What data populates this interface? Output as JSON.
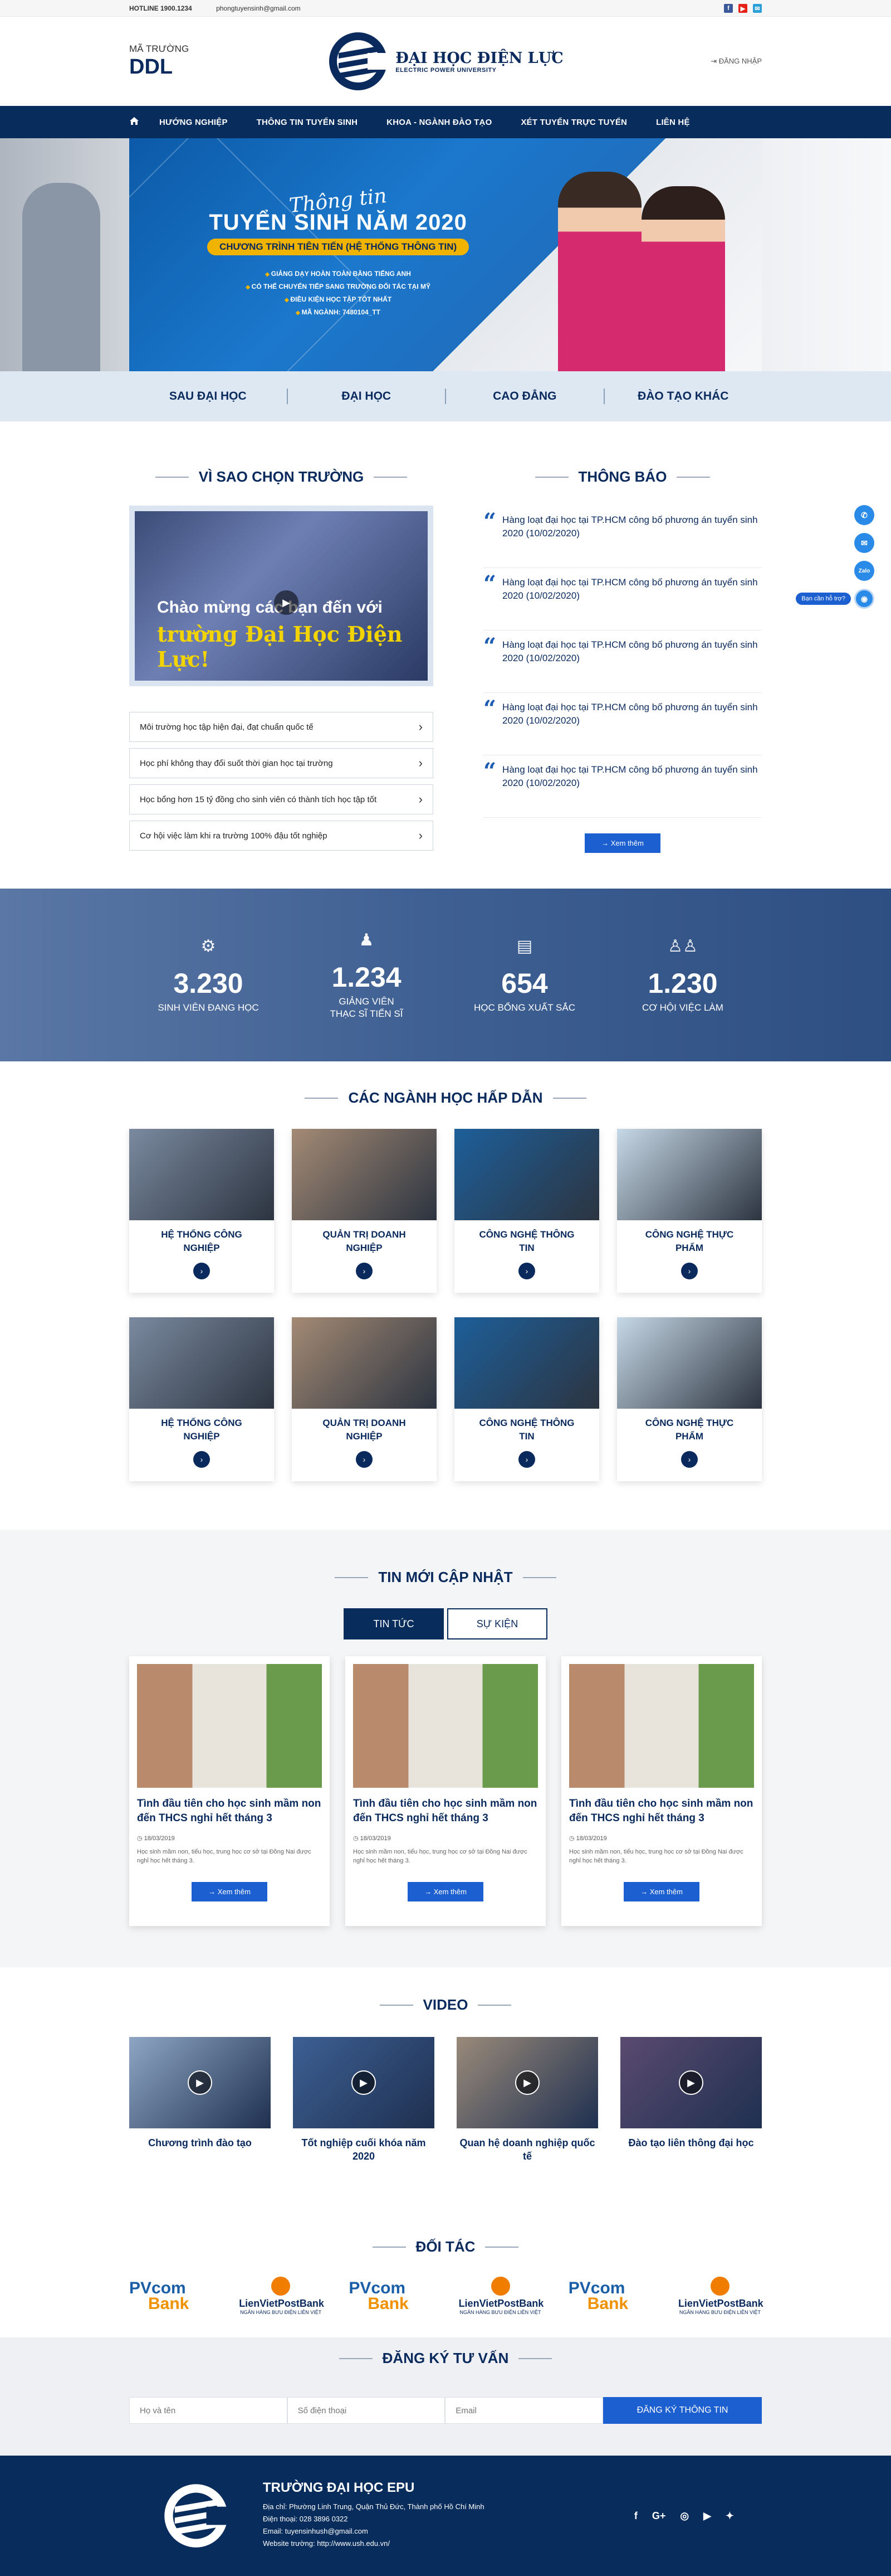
{
  "topbar": {
    "hotline": "HOTLINE 1900.1234",
    "email": "phongtuyensinh@gmail.com"
  },
  "header": {
    "code_label": "MÃ TRƯỜNG",
    "code": "DDL",
    "logo_title": "ĐẠI HỌC ĐIỆN LỰC",
    "logo_sub": "ELECTRIC POWER UNIVERSITY",
    "login": "ĐĂNG NHẬP"
  },
  "nav": [
    "HƯỚNG NGHIỆP",
    "THÔNG TIN TUYỂN SINH",
    "KHOA - NGÀNH ĐÀO TẠO",
    "XÉT TUYỂN TRỰC TUYẾN",
    "LIÊN HỆ"
  ],
  "hero": {
    "script": "Thông tin",
    "title": "TUYỂN SINH NĂM 2020",
    "pill": "CHƯƠNG TRÌNH TIÊN TIẾN (HỆ THỐNG THÔNG TIN)",
    "bullets": [
      "GIẢNG DẠY HOÀN TOÀN BẰNG TIẾNG ANH",
      "CÓ THỂ CHUYỂN TIẾP SANG TRƯỜNG ĐỐI TÁC TẠI MỸ",
      "ĐIỀU KIỆN HỌC TẬP TỐT NHẤT",
      "MÃ NGÀNH: 7480104_TT"
    ]
  },
  "programs": [
    "SAU ĐẠI HỌC",
    "ĐẠI HỌC",
    "CAO ĐẲNG",
    "ĐÀO TẠO KHÁC"
  ],
  "why": {
    "title": "VÌ SAO CHỌN TRƯỜNG",
    "video_line1": "Chào mừng các bạn đến với",
    "video_line2": "trường Đại Học Điện Lực!",
    "items": [
      "Môi trường học tập hiện đại, đạt chuẩn quốc tế",
      "Học phí không thay đổi suốt thời gian học tại trường",
      "Học bổng hơn 15 tỷ đồng cho sinh viên có thành tích học tập tốt",
      "Cơ hội việc làm khi ra trường 100% đậu tốt nghiệp"
    ]
  },
  "notices": {
    "title": "THÔNG BÁO",
    "items": [
      "Hàng loạt đại học tại TP.HCM công bố phương án tuyển sinh 2020 (10/02/2020)",
      "Hàng loạt đại học tại TP.HCM công bố phương án tuyển sinh 2020 (10/02/2020)",
      "Hàng loạt đại học tại TP.HCM công bố phương án tuyển sinh 2020 (10/02/2020)",
      "Hàng loạt đại học tại TP.HCM công bố phương án tuyển sinh 2020 (10/02/2020)",
      "Hàng loạt đại học tại TP.HCM công bố phương án tuyển sinh 2020 (10/02/2020)"
    ],
    "more": "Xem thêm"
  },
  "stats": [
    {
      "num": "3.230",
      "label": "SINH VIÊN ĐANG HỌC"
    },
    {
      "num": "1.234",
      "label": "GIẢNG VIÊN THẠC SĨ TIẾN SĨ"
    },
    {
      "num": "654",
      "label": "HỌC BỔNG XUẤT SẮC"
    },
    {
      "num": "1.230",
      "label": "CƠ HỘI VIỆC LÀM"
    }
  ],
  "majors": {
    "title": "CÁC NGÀNH HỌC HẤP DẪN",
    "items": [
      "HỆ THỐNG CÔNG NGHIỆP",
      "QUẢN TRỊ DOANH NGHIỆP",
      "CÔNG NGHỆ THÔNG TIN",
      "CÔNG NGHỆ THỰC PHẨM",
      "HỆ THỐNG CÔNG NGHIỆP",
      "QUẢN TRỊ DOANH NGHIỆP",
      "CÔNG NGHỆ THÔNG TIN",
      "CÔNG NGHỆ THỰC PHẨM"
    ],
    "colors": [
      "#7b8aa0",
      "#a48a74",
      "#1d5f9a",
      "#c7d8e6",
      "#7b8aa0",
      "#a48a74",
      "#1d5f9a",
      "#c7d8e6"
    ]
  },
  "news": {
    "title": "TIN MỚI CẬP NHẬT",
    "tab_news": "TIN TỨC",
    "tab_events": "SỰ KIỆN",
    "items": [
      {
        "title": "Tình đầu tiên cho học sinh mầm non đến THCS nghỉ hết tháng 3",
        "date": "18/03/2019",
        "desc": "Học sinh mầm non, tiểu học, trung học cơ sở tại Đồng Nai được nghỉ học hết tháng 3.",
        "more": "Xem thêm"
      },
      {
        "title": "Tình đầu tiên cho học sinh mầm non đến THCS nghỉ hết tháng 3",
        "date": "18/03/2019",
        "desc": "Học sinh mầm non, tiểu học, trung học cơ sở tại Đồng Nai được nghỉ học hết tháng 3.",
        "more": "Xem thêm"
      },
      {
        "title": "Tình đầu tiên cho học sinh mầm non đến THCS nghỉ hết tháng 3",
        "date": "18/03/2019",
        "desc": "Học sinh mầm non, tiểu học, trung học cơ sở tại Đồng Nai được nghỉ học hết tháng 3.",
        "more": "Xem thêm"
      }
    ]
  },
  "videos": {
    "title": "VIDEO",
    "items": [
      "Chương trình đào tạo",
      "Tốt nghiệp cuối khóa năm 2020",
      "Quan hệ doanh nghiệp quốc tế",
      "Đào tạo liên thông đại học"
    ],
    "colors": [
      "#8ea6c4",
      "#3c5f93",
      "#9a8a7a",
      "#5a4a70"
    ]
  },
  "partners": {
    "title": "ĐỐI TÁC",
    "items": [
      {
        "type": "pv",
        "a": "PVcom",
        "b": "Bank"
      },
      {
        "type": "lv",
        "a": "LienVietPostBank",
        "b": "NGÂN HÀNG BƯU ĐIỆN LIÊN VIỆT"
      },
      {
        "type": "pv",
        "a": "PVcom",
        "b": "Bank"
      },
      {
        "type": "lv",
        "a": "LienVietPostBank",
        "b": "NGÂN HÀNG BƯU ĐIỆN LIÊN VIỆT"
      },
      {
        "type": "pv",
        "a": "PVcom",
        "b": "Bank"
      },
      {
        "type": "lv",
        "a": "LienVietPostBank",
        "b": "NGÂN HÀNG BƯU ĐIỆN LIÊN VIỆT"
      }
    ]
  },
  "consult": {
    "title": "ĐĂNG KÝ TƯ VẤN",
    "name_ph": "Họ và tên",
    "phone_ph": "Số điện thoại",
    "email_ph": "Email",
    "submit": "ĐĂNG KÝ THÔNG TIN"
  },
  "footer": {
    "name": "TRƯỜNG ĐẠI HỌC EPU",
    "address": "Địa chỉ: Phường Linh Trung, Quận Thủ Đức, Thành phố Hồ Chí Minh",
    "phone": "Điện thoại: 028 3896 0322",
    "email": "Email: tuyensinhush@gmail.com",
    "website": "Website trường: http://www.ush.edu.vn/"
  },
  "floating": {
    "help": "Bạn cần hỗ trợ?",
    "zalo": "Zalo"
  },
  "brand_colors": {
    "navy": "#082c5c",
    "blue": "#1c5fd0",
    "gold": "#f0b400"
  }
}
